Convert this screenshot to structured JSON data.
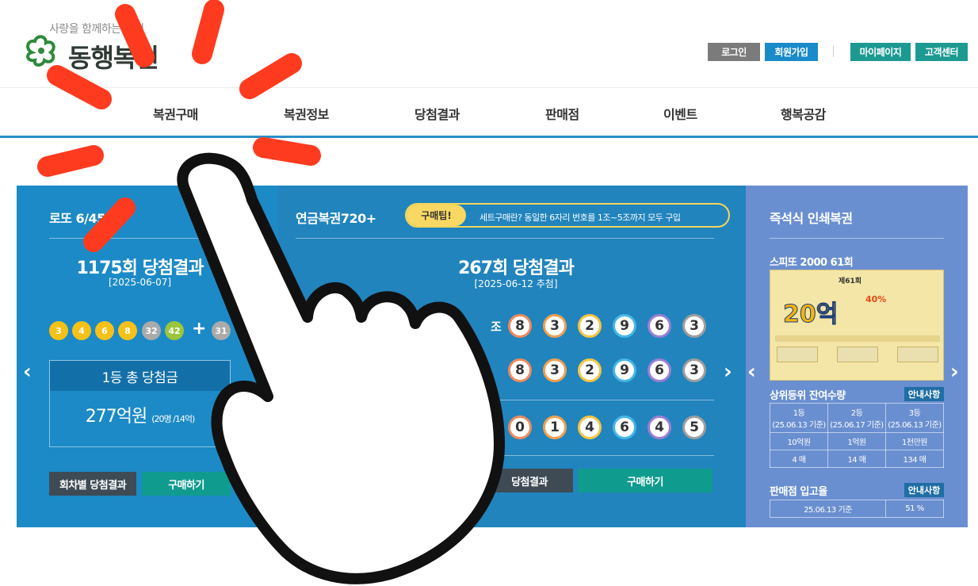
{
  "header": {
    "logo_sub": "사랑을 함께하는 동행",
    "logo_main": "동행복권",
    "buttons": {
      "login": "로그인",
      "join": "회원가입",
      "mypage": "마이페이지",
      "cs": "고객센터"
    }
  },
  "nav": {
    "items": [
      "복권구매",
      "복권정보",
      "당첨결과",
      "판매점",
      "이벤트",
      "행복공감"
    ]
  },
  "lotto": {
    "title": "로또 6/45",
    "round_title": "1175회 당첨결과",
    "date": "[2025-06-07]",
    "balls": [
      "3",
      "4",
      "6",
      "8",
      "32",
      "42"
    ],
    "bonus": "31",
    "prize_head": "1등 총 당첨금",
    "prize_amount": "277억원",
    "prize_note": "(20명 /14억)",
    "btn_history": "회차별 당첨결과",
    "btn_buy": "구매하기"
  },
  "pension": {
    "title": "연금복권720+",
    "tip_tag": "구매팁!",
    "tip_text": "세트구매란? 동일한 6자리 번호를 1조~5조까지 모두 구입",
    "round_title": "267회 당첨결과",
    "date": "[2025-06-12 추첨]",
    "jo_label": "조",
    "row1": [
      "8",
      "3",
      "2",
      "9",
      "6",
      "3"
    ],
    "row2": [
      "8",
      "3",
      "2",
      "9",
      "6",
      "3"
    ],
    "row3": [
      "0",
      "1",
      "4",
      "6",
      "4",
      "5"
    ],
    "btn_history": "당첨결과",
    "btn_buy": "구매하기"
  },
  "instant": {
    "title": "즉석식 인쇄복권",
    "spito_title": "스피또 2000 61회",
    "ticket_round": "제61회",
    "ticket_big": "20억",
    "ticket_badge": "40%",
    "stock_title": "상위등위 잔여수량",
    "info_label": "안내사항",
    "stock_headers": [
      "1등\n(25.06.13 기준)",
      "2등\n(25.06.17 기준)",
      "3등\n(25.06.13 기준)"
    ],
    "stock_amounts": [
      "10억원",
      "1억원",
      "1천만원"
    ],
    "stock_counts": [
      "4 매",
      "14 매",
      "134 매"
    ],
    "rate_title": "판매점 입고율",
    "rate_label": "25.06.13 기준",
    "rate_value": "51 %"
  },
  "colors": {
    "lotto_bg": "#1c8ac6",
    "pension_bg": "#2184bd",
    "instant_bg": "#6a8fd0",
    "nav_underline": "#2a8fc7",
    "teal": "#0f9b8e"
  }
}
